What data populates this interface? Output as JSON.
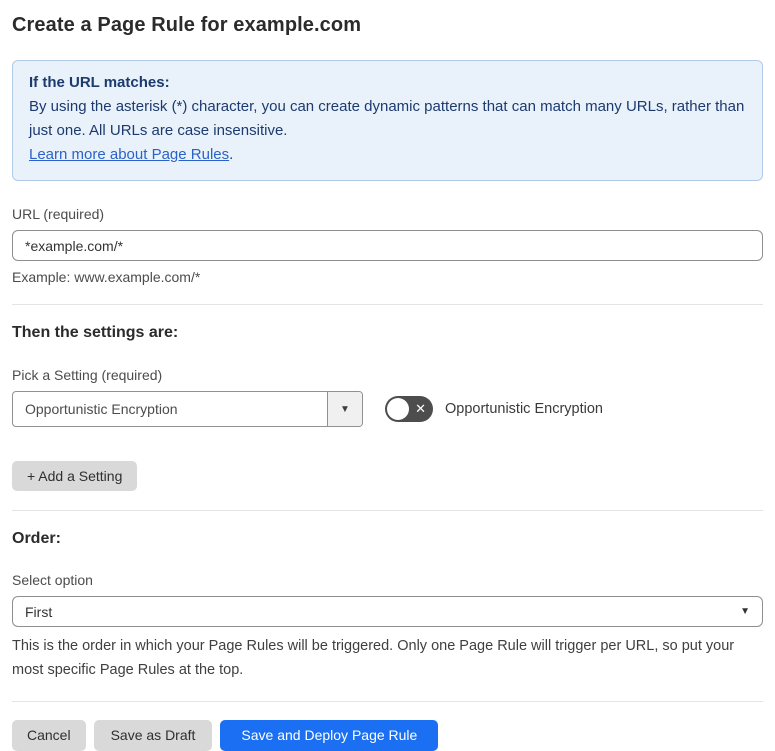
{
  "page": {
    "title": "Create a Page Rule for example.com"
  },
  "info_box": {
    "heading": "If the URL matches:",
    "body": "By using the asterisk (*) character, you can create dynamic patterns that can match many URLs, rather than just one. All URLs are case insensitive.",
    "link_label": "Learn more about Page Rules",
    "link_suffix": "."
  },
  "url_field": {
    "label": "URL (required)",
    "value": "*example.com/*",
    "helper": "Example: www.example.com/*"
  },
  "settings_section": {
    "heading": "Then the settings are:",
    "picker_label": "Pick a Setting (required)",
    "selected_setting": "Opportunistic Encryption",
    "dropdown_arrow_icon": "▼",
    "toggle_state": "off",
    "toggle_icon": "✕",
    "toggle_label": "Opportunistic Encryption",
    "add_setting_label": "+ Add a Setting"
  },
  "order_section": {
    "heading": "Order:",
    "select_label": "Select option",
    "selected_option": "First",
    "select_caret_icon": "▼",
    "helper": "This is the order in which your Page Rules will be triggered. Only one Page Rule will trigger per URL, so put your most specific Page Rules at the top."
  },
  "footer": {
    "cancel_label": "Cancel",
    "save_draft_label": "Save as Draft",
    "save_deploy_label": "Save and Deploy Page Rule"
  },
  "colors": {
    "accent_blue": "#1a6ff3",
    "info_background": "#e9f2fb",
    "info_border": "#b0cbe9",
    "info_text": "#1c3a6e",
    "link_blue": "#2b62c9",
    "toggle_off_background": "#4d4d4d",
    "button_gray": "#d9d9d9"
  }
}
